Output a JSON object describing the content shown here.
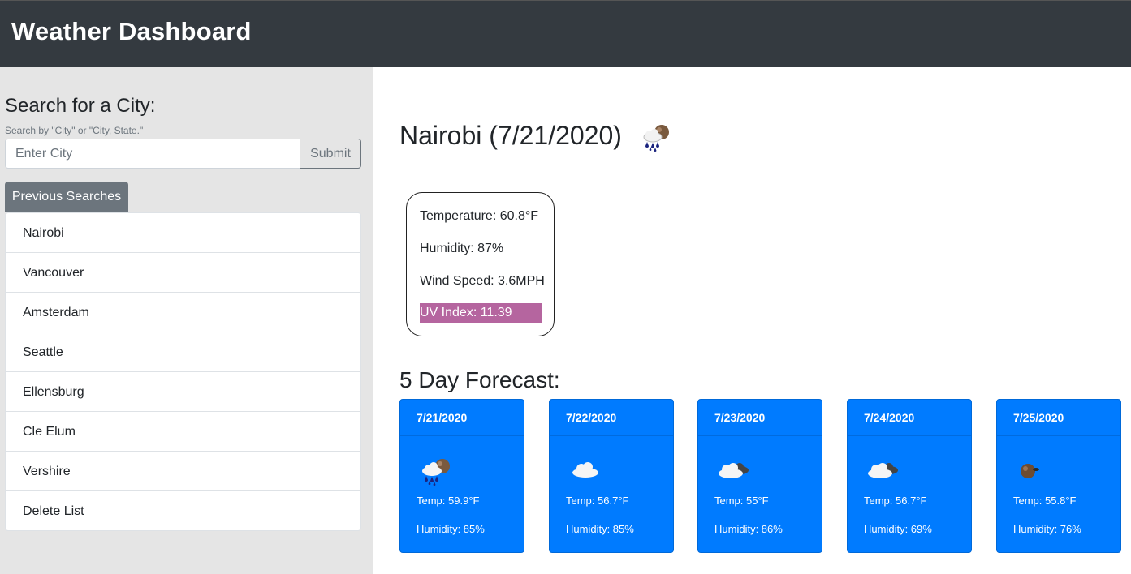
{
  "header": {
    "title": "Weather Dashboard"
  },
  "search": {
    "title": "Search for a City:",
    "help": "Search by \"City\" or \"City, State.\"",
    "placeholder": "Enter City",
    "value": "",
    "submit_label": "Submit"
  },
  "previous": {
    "label": "Previous Searches",
    "items": [
      "Nairobi",
      "Vancouver",
      "Amsterdam",
      "Seattle",
      "Ellensburg",
      "Cle Elum",
      "Vershire",
      "Delete List"
    ]
  },
  "current": {
    "title": "Nairobi (7/21/2020)",
    "icon": "rain-cloud-icon",
    "temperature": "Temperature: 60.8°F",
    "humidity": "Humidity: 87%",
    "wind": "Wind Speed: 3.6MPH",
    "uv": "UV Index: 11.39",
    "uv_color": "#b5659f"
  },
  "forecast": {
    "title": "5 Day Forecast:",
    "card_color": "#007bff",
    "days": [
      {
        "date": "7/21/2020",
        "icon": "rain-cloud-icon",
        "temp": "Temp: 59.9°F",
        "humidity": "Humidity: 85%"
      },
      {
        "date": "7/22/2020",
        "icon": "cloud-icon",
        "temp": "Temp: 56.7°F",
        "humidity": "Humidity: 85%"
      },
      {
        "date": "7/23/2020",
        "icon": "broken-clouds-icon",
        "temp": "Temp: 55°F",
        "humidity": "Humidity: 86%"
      },
      {
        "date": "7/24/2020",
        "icon": "broken-clouds-icon",
        "temp": "Temp: 56.7°F",
        "humidity": "Humidity: 69%"
      },
      {
        "date": "7/25/2020",
        "icon": "few-clouds-icon",
        "temp": "Temp: 55.8°F",
        "humidity": "Humidity: 76%"
      }
    ]
  }
}
